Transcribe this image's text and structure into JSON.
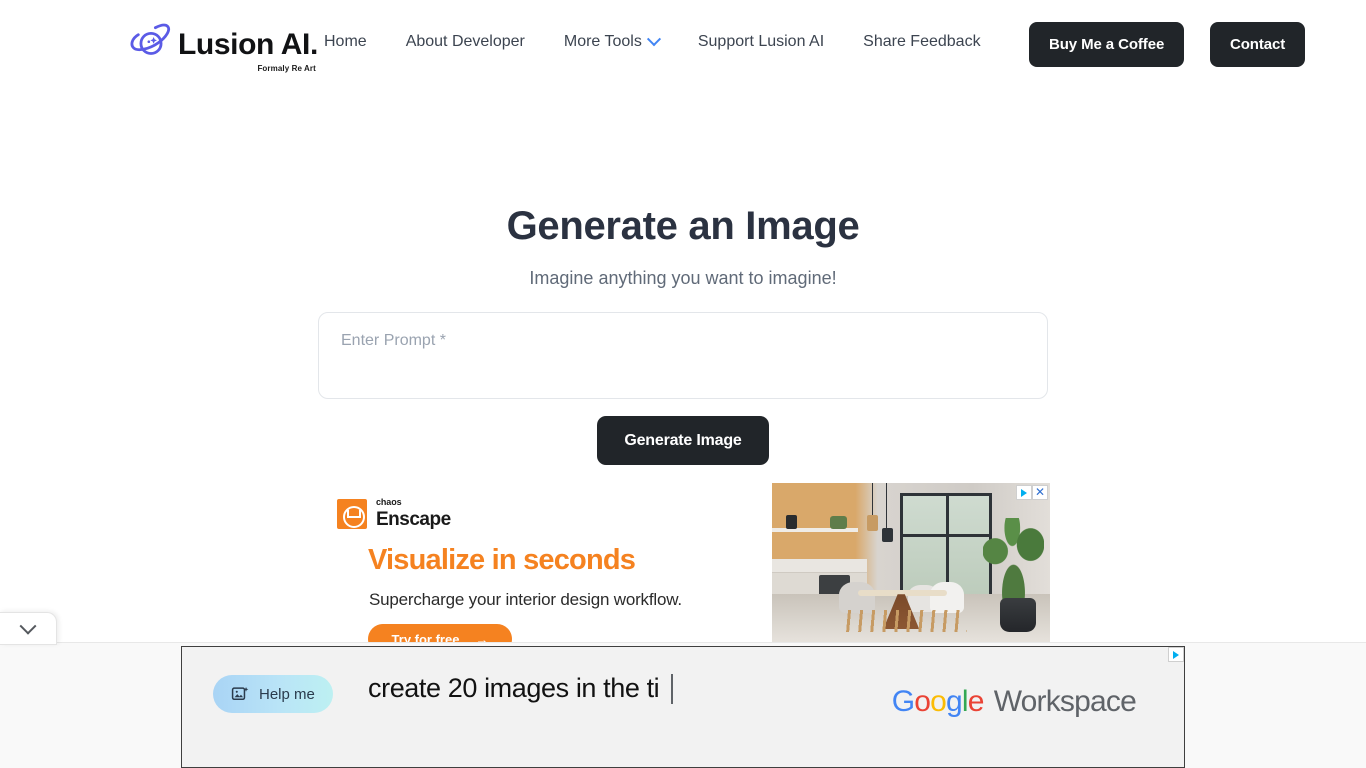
{
  "header": {
    "logo": {
      "icon": "planet-sparkle-icon",
      "title": "Lusion AI.",
      "tagline": "Formaly Re Art"
    },
    "nav": [
      {
        "label": "Home",
        "icon": null
      },
      {
        "label": "About Developer",
        "icon": null
      },
      {
        "label": "More Tools",
        "icon": "chevron-down-icon"
      },
      {
        "label": "Support Lusion AI",
        "icon": null
      },
      {
        "label": "Share Feedback",
        "icon": null
      }
    ],
    "buttons": {
      "coffee": "Buy Me a Coffee",
      "contact": "Contact"
    }
  },
  "main": {
    "title": "Generate an Image",
    "subtitle": "Imagine anything you want to imagine!",
    "prompt": {
      "value": "",
      "placeholder": "Enter Prompt *"
    },
    "generate_button": "Generate Image"
  },
  "ads": {
    "enscape": {
      "brand_small": "chaos",
      "brand": "Enscape",
      "headline": "Visualize in seconds",
      "subhead": "Supercharge your interior design workflow.",
      "cta": "Try for free",
      "cta_arrow": "→",
      "adchoices_icon": "adchoices-triangle-icon",
      "close_icon": "close-icon",
      "accent_color": "#f58220",
      "image_alt": "interior-dining-room-render"
    },
    "google_workspace": {
      "pill_label": "Help me",
      "pill_icon": "image-sparkle-icon",
      "typed_text": "create 20 images in the ti",
      "brand_google": "Google",
      "brand_suffix": "Workspace",
      "adchoices_icon": "adchoices-triangle-icon",
      "google_letters": [
        "G",
        "o",
        "o",
        "g",
        "l",
        "e"
      ]
    }
  },
  "controls": {
    "collapse_tab_icon": "chevron-down-icon"
  },
  "colors": {
    "button_dark": "#212529",
    "heading": "#2b3241",
    "nav_text": "#3c4450",
    "chevron_blue": "#4285f4",
    "logo_purple": "#5b5be6",
    "enscape_orange": "#f58220"
  }
}
